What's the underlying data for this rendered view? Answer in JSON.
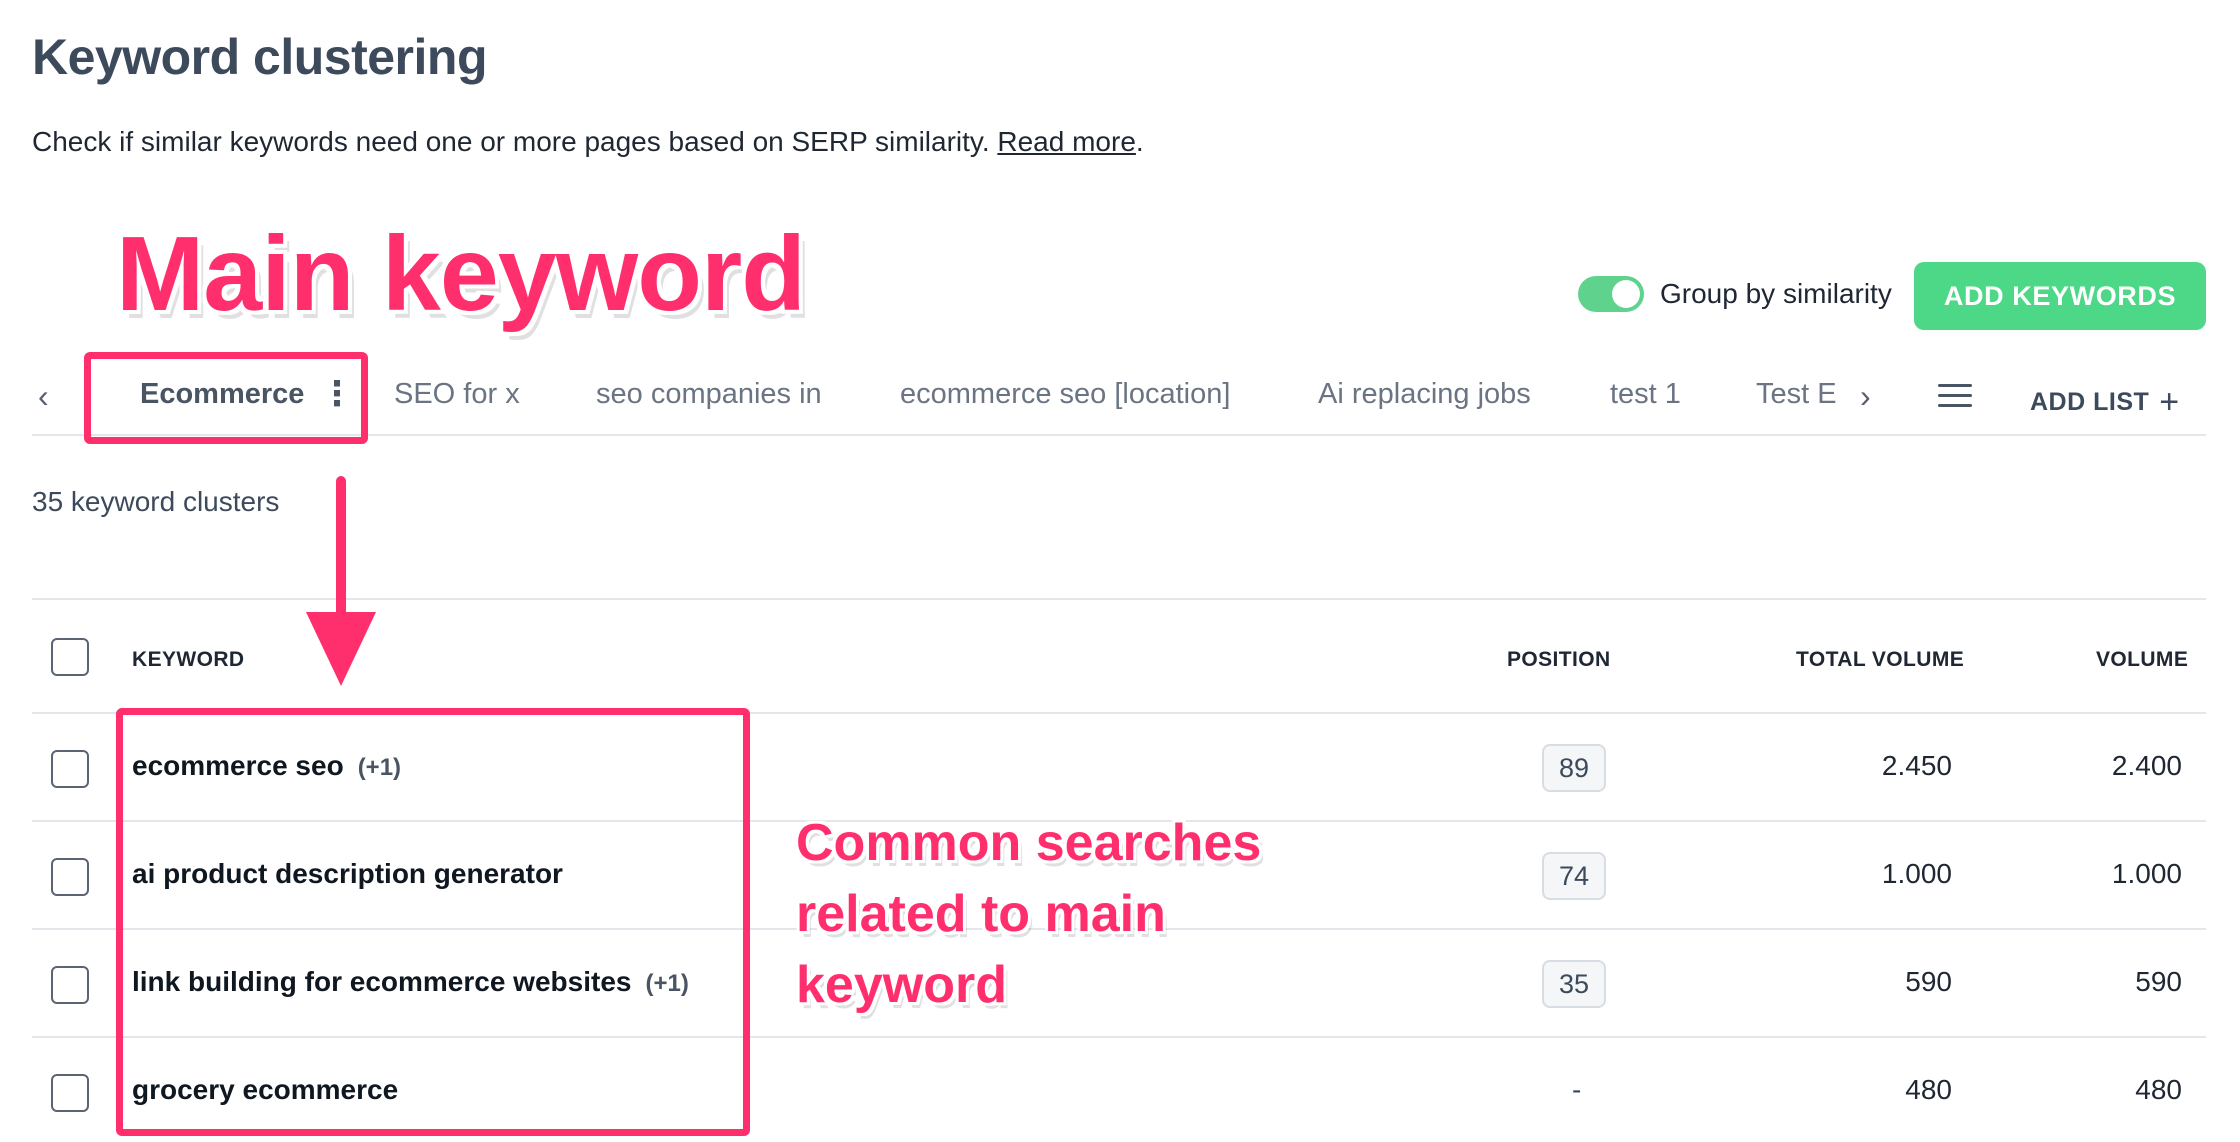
{
  "header": {
    "title": "Keyword clustering",
    "subtitle": "Check if similar keywords need one or more pages based on SERP similarity.",
    "read_more": "Read more",
    "subtitle_end": "."
  },
  "annotations": {
    "main_keyword": "Main keyword",
    "common_line1": "Common searches",
    "common_line2": "related to main",
    "common_line3": "keyword",
    "color": "#ff2f6e"
  },
  "controls": {
    "group_by_similarity": "Group by similarity",
    "group_by_similarity_on": true,
    "add_keywords": "ADD KEYWORDS",
    "accent_color": "#4cd886"
  },
  "tabs": {
    "items": [
      {
        "label": "Ecommerce",
        "active": true
      },
      {
        "label": "SEO for x"
      },
      {
        "label": "seo companies in"
      },
      {
        "label": "ecommerce seo [location]"
      },
      {
        "label": "Ai replacing jobs"
      },
      {
        "label": "test 1"
      },
      {
        "label": "Test E"
      }
    ],
    "more_icon": "⋮",
    "prev_icon": "‹",
    "next_icon": "›",
    "add_list": "ADD LIST",
    "add_list_icon": "+"
  },
  "summary": {
    "cluster_count": "35 keyword clusters"
  },
  "table": {
    "columns": {
      "keyword": "KEYWORD",
      "position": "POSITION",
      "total_volume": "TOTAL VOLUME",
      "volume": "VOLUME"
    },
    "rows": [
      {
        "keyword": "ecommerce seo",
        "extra": "(+1)",
        "position": "89",
        "total_volume": "2.450",
        "volume": "2.400"
      },
      {
        "keyword": "ai product description generator",
        "extra": "",
        "position": "74",
        "total_volume": "1.000",
        "volume": "1.000"
      },
      {
        "keyword": "link building for ecommerce websites",
        "extra": "(+1)",
        "position": "35",
        "total_volume": "590",
        "volume": "590"
      },
      {
        "keyword": "grocery ecommerce",
        "extra": "",
        "position": "-",
        "total_volume": "480",
        "volume": "480"
      }
    ]
  }
}
